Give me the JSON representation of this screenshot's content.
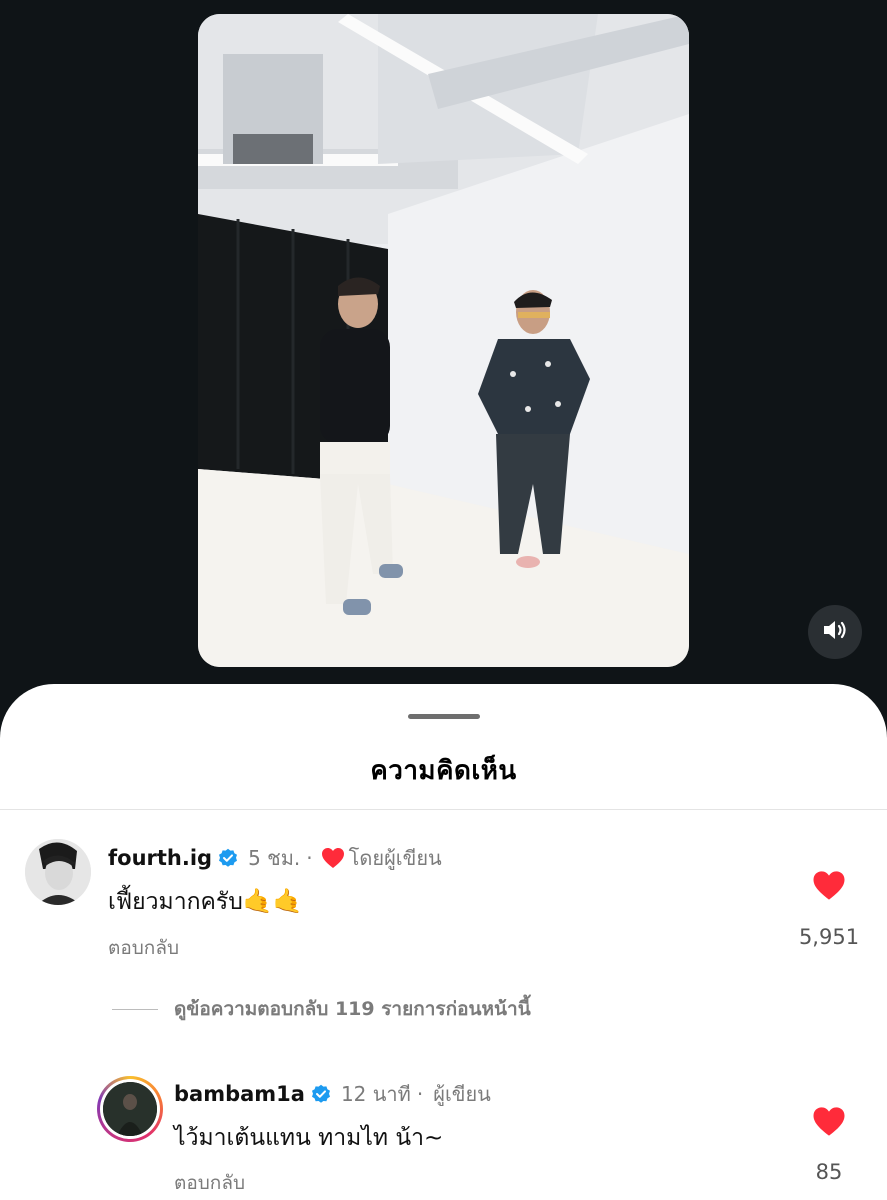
{
  "video": {
    "volume_icon": "speaker-volume-icon"
  },
  "sheet": {
    "title": "ความคิดเห็น"
  },
  "comments": [
    {
      "username": "fourth.ig",
      "verified": true,
      "time": "5 ชม.",
      "separator": "·",
      "liked_by_author_label": "โดยผู้เขียน",
      "text": "เฟี้ยวมากครับ",
      "emoji": "🤙🤙",
      "reply_label": "ตอบกลับ",
      "likes": "5,951"
    },
    {
      "username": "bambam1a",
      "verified": true,
      "time": "12 นาที",
      "separator": "·",
      "author_label": "ผู้เขียน",
      "text": "ไว้มาเต้นแทน ทามไท น้า~",
      "reply_label": "ตอบกลับ",
      "likes": "85"
    }
  ],
  "view_replies": {
    "label": "ดูข้อความตอบกลับ 119 รายการก่อนหน้านี้"
  },
  "colors": {
    "background": "#0f1417",
    "sheet": "#ffffff",
    "heart": "#ff2b3a",
    "verified": "#1d9bf0",
    "muted_text": "#7b7b7b"
  }
}
